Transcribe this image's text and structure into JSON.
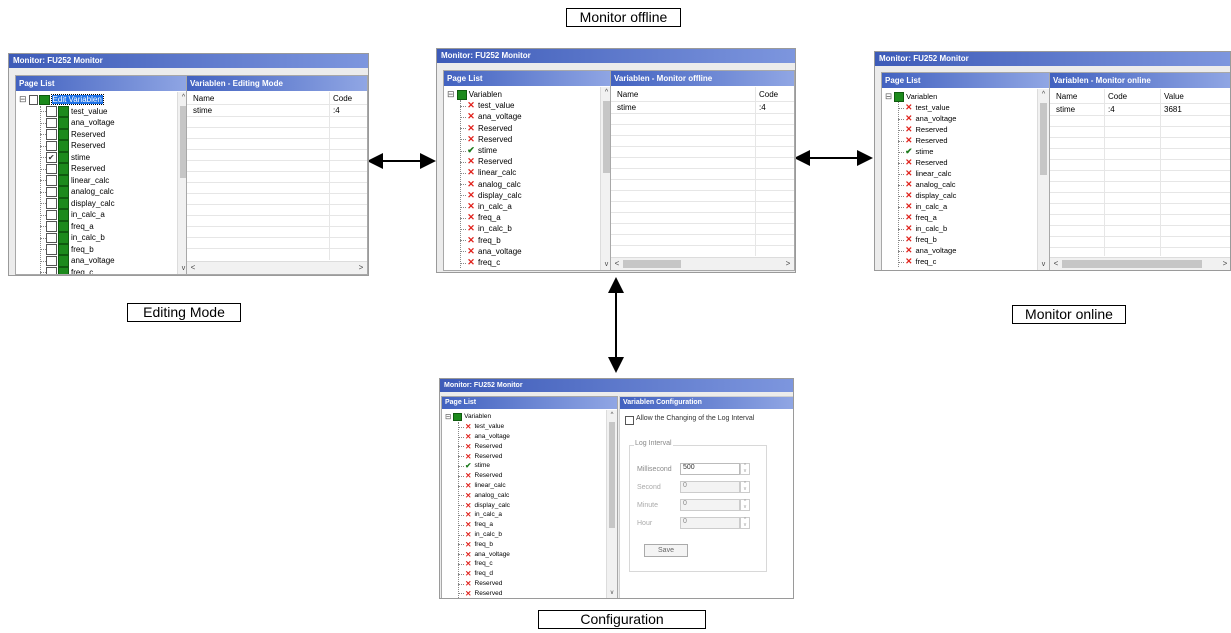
{
  "captions": {
    "editing": "Editing Mode",
    "offline": "Monitor offline",
    "online": "Monitor online",
    "configuration": "Configuration"
  },
  "window_title": "Monitor: FU252 Monitor",
  "page_list_header": "Page List",
  "tree_root": "Variablen",
  "tree_root_editing": "Edit Variablen",
  "items_editing": [
    "test_value",
    "ana_voltage",
    "Reserved",
    "Reserved",
    "stime",
    "Reserved",
    "linear_calc",
    "analog_calc",
    "display_calc",
    "in_calc_a",
    "freq_a",
    "in_calc_b",
    "freq_b",
    "ana_voltage",
    "freq_c"
  ],
  "items_monitor": [
    "test_value",
    "ana_voltage",
    "Reserved",
    "Reserved",
    "stime",
    "Reserved",
    "linear_calc",
    "analog_calc",
    "display_calc",
    "in_calc_a",
    "freq_a",
    "in_calc_b",
    "freq_b",
    "ana_voltage",
    "freq_c"
  ],
  "items_config": [
    "test_value",
    "ana_voltage",
    "Reserved",
    "Reserved",
    "stime",
    "Reserved",
    "linear_calc",
    "analog_calc",
    "display_calc",
    "in_calc_a",
    "freq_a",
    "in_calc_b",
    "freq_b",
    "ana_voltage",
    "freq_c",
    "freq_d",
    "Reserved",
    "Reserved"
  ],
  "checked_item": "stime",
  "editing_pane": {
    "header": "Variablen - Editing Mode",
    "col_name": "Name",
    "col_code": "Code",
    "row_name": "stime",
    "row_code": ":4"
  },
  "offline_pane": {
    "header": "Variablen - Monitor offline",
    "col_name": "Name",
    "col_code": "Code",
    "row_name": "stime",
    "row_code": ":4"
  },
  "online_pane": {
    "header": "Variablen - Monitor online",
    "col_name": "Name",
    "col_code": "Code",
    "col_value": "Value",
    "row_name": "stime",
    "row_code": ":4",
    "row_value": "3681"
  },
  "config_pane": {
    "header": "Variablen   Configuration",
    "allow_label": "Allow the Changing of the Log Interval",
    "group_label": "Log Interval",
    "millisecond_label": "Millisecond",
    "millisecond_value": "500",
    "second_label": "Second",
    "second_value": "0",
    "minute_label": "Minute",
    "minute_value": "0",
    "hour_label": "Hour",
    "hour_value": "0",
    "save_label": "Save"
  },
  "icons": {
    "scroll_up": "▲",
    "scroll_down": "▼",
    "scroll_left": "<",
    "scroll_right": ">",
    "up_small": "^",
    "down_small": "v",
    "x_mark": "✕",
    "check": "✔",
    "minus": "−"
  },
  "colors": {
    "title_bar": "#3d5bb8",
    "green_box": "#1c8a1c",
    "x_mark": "#e0201a",
    "check_mark": "#1b7a1b"
  }
}
